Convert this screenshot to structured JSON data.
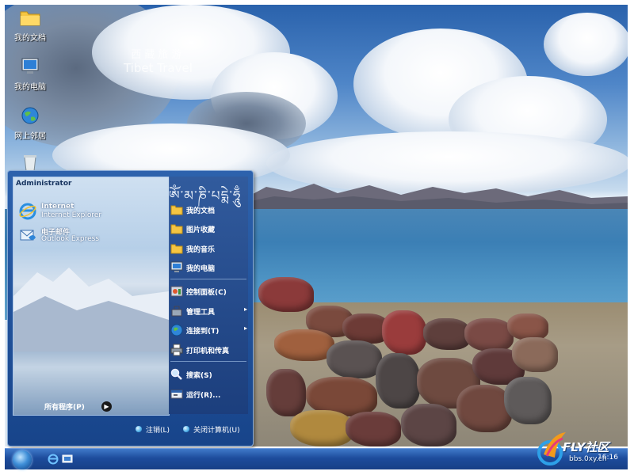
{
  "desktop": {
    "watermark": {
      "chinese": "西藏旅游",
      "english": "Tibet Travel"
    },
    "icons": [
      {
        "label": "我的文档",
        "icon": "folder-icon"
      },
      {
        "label": "我的电脑",
        "icon": "computer-icon"
      },
      {
        "label": "网上邻居",
        "icon": "network-globe-icon"
      },
      {
        "label": "",
        "icon": "recycle-bin-icon"
      }
    ]
  },
  "start_menu": {
    "user_name": "Administrator",
    "pinned": [
      {
        "title": "Internet",
        "subtitle": "Internet Explorer",
        "icon": "internet-explorer-icon"
      },
      {
        "title": "电子邮件",
        "subtitle": "Outlook Express",
        "icon": "outlook-express-icon"
      }
    ],
    "all_programs": "所有程序(P)",
    "tibetan_banner": "ཨོཾ་མ་ཎི་པདྨེ་ཧཱུྃ",
    "right_items": [
      {
        "label": "我的文档",
        "icon": "folder-icon",
        "submenu": false
      },
      {
        "label": "图片收藏",
        "icon": "folder-icon",
        "submenu": false
      },
      {
        "label": "我的音乐",
        "icon": "folder-icon",
        "submenu": false
      },
      {
        "label": "我的电脑",
        "icon": "computer-icon",
        "submenu": false
      },
      {
        "label": "控制面板(C)",
        "icon": "control-panel-icon",
        "submenu": false
      },
      {
        "label": "管理工具",
        "icon": "admin-tools-icon",
        "submenu": true
      },
      {
        "label": "连接到(T)",
        "icon": "network-globe-icon",
        "submenu": true
      },
      {
        "label": "打印机和传真",
        "icon": "printer-icon",
        "submenu": false
      },
      {
        "label": "搜索(S)",
        "icon": "search-icon",
        "submenu": false
      },
      {
        "label": "运行(R)...",
        "icon": "run-icon",
        "submenu": false
      }
    ],
    "submenu_arrow": "▸",
    "all_programs_arrow": "▶",
    "footer": {
      "logoff": "注销(L)",
      "shutdown": "关闭计算机(U)"
    }
  },
  "taskbar": {
    "clock": "16:16"
  },
  "logo": {
    "brand": "FLY社区",
    "url": "bbs.0xy.cn"
  },
  "colors": {
    "taskbar": "#1d4c9c",
    "menu_bg": "#17448a",
    "accent": "#58b7ec"
  }
}
